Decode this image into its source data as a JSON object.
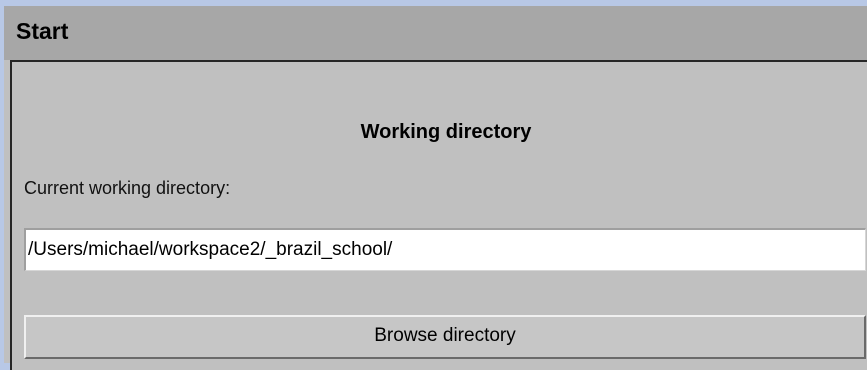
{
  "window": {
    "title": "Start"
  },
  "section": {
    "heading": "Working directory"
  },
  "working_directory": {
    "label": "Current working directory:",
    "value": "/Users/michael/workspace2/_brazil_school/"
  },
  "actions": {
    "browse_label": "Browse directory"
  },
  "colors": {
    "background": "#b8c8e6",
    "titlebar": "#a7a7a7",
    "panel": "#c0c0c0",
    "border": "#262626"
  }
}
